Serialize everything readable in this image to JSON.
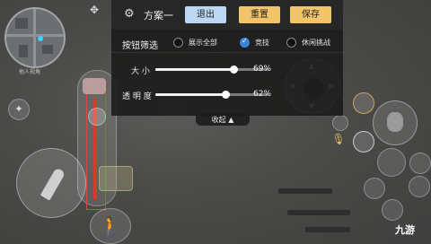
{
  "map": {
    "caption": "他人视角"
  },
  "panel": {
    "scheme_name": "方案一",
    "exit_label": "退出",
    "reset_label": "重置",
    "save_label": "保存",
    "filter_label": "按钮筛选",
    "filter_options": [
      {
        "label": "展示全部",
        "selected": false
      },
      {
        "label": "竞技",
        "selected": true
      },
      {
        "label": "休闲挑战",
        "selected": false
      }
    ],
    "sliders": [
      {
        "label": "大 小",
        "value_text": "69%",
        "fraction": 0.69
      },
      {
        "label": "透 明 度",
        "value_text": "62%",
        "fraction": 0.62
      }
    ],
    "collapse_label": "收起"
  },
  "watermark": "九游",
  "colors": {
    "accent_blue": "#3b86d6",
    "exit_btn": "#bcd7f2",
    "gold_btn": "#f3c56b",
    "fire_red": "#d63a2a"
  },
  "icons": [
    "gear-icon",
    "gamepad-icon",
    "grenade-icon",
    "bullet-icon",
    "crouch-icon",
    "mic-icon",
    "emote-icon"
  ]
}
